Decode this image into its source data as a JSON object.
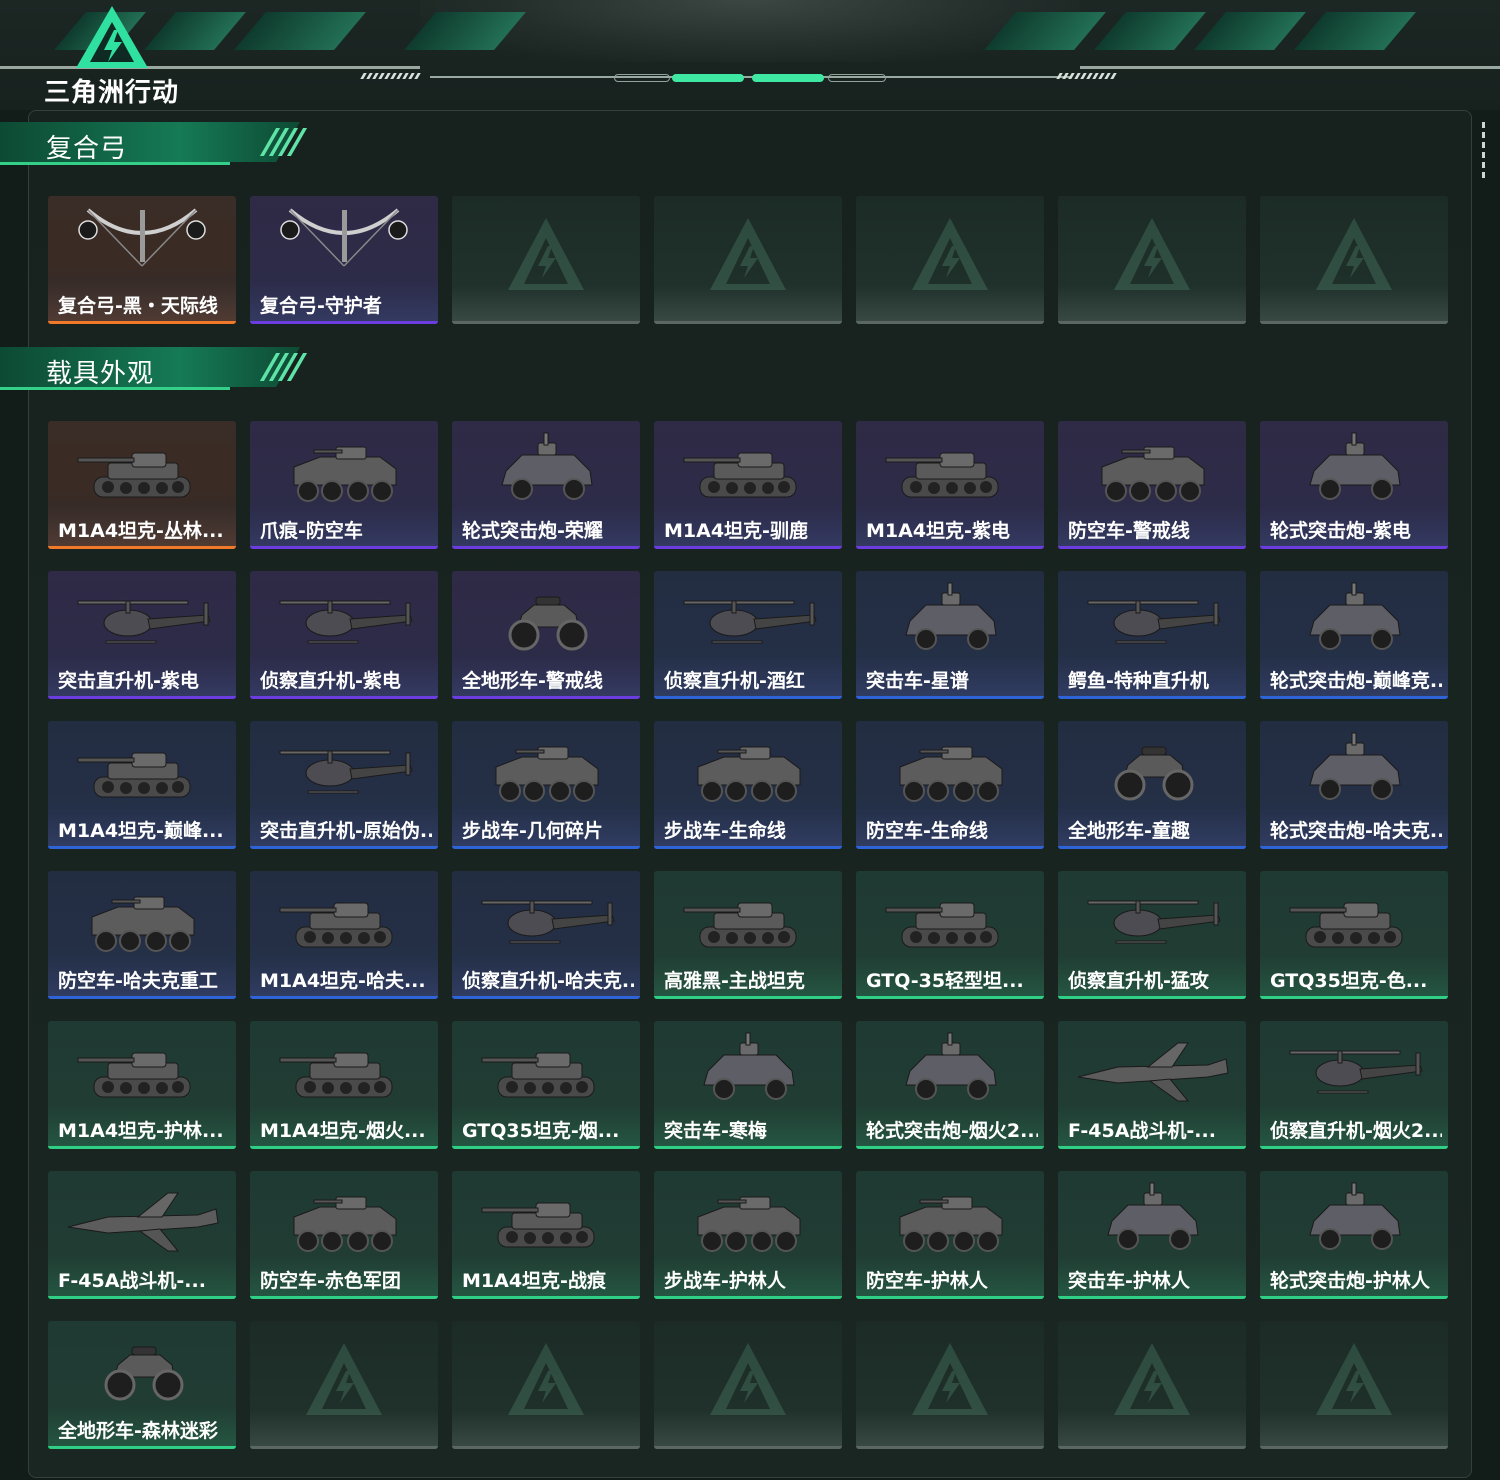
{
  "app": {
    "logo_text": "三角洲行动"
  },
  "colors": {
    "accent": "#34d08a",
    "orange": "#f07a2a",
    "purple": "#6b3de0",
    "blue": "#2f63d8",
    "green": "#2fcf85"
  },
  "sections": [
    {
      "title": "复合弓",
      "items": [
        {
          "label": "复合弓-黑・天际线",
          "rarity": "orange",
          "icon": "bow-icon"
        },
        {
          "label": "复合弓-守护者",
          "rarity": "purple",
          "icon": "bow-icon"
        },
        {
          "label": "",
          "rarity": "empty",
          "icon": ""
        },
        {
          "label": "",
          "rarity": "empty",
          "icon": ""
        },
        {
          "label": "",
          "rarity": "empty",
          "icon": ""
        },
        {
          "label": "",
          "rarity": "empty",
          "icon": ""
        },
        {
          "label": "",
          "rarity": "empty",
          "icon": ""
        }
      ]
    },
    {
      "title": "载具外观",
      "items": [
        {
          "label": "M1A4坦克-丛林...",
          "rarity": "orange",
          "icon": "tank-icon"
        },
        {
          "label": "爪痕-防空车",
          "rarity": "purple",
          "icon": "apc-icon"
        },
        {
          "label": "轮式突击炮-荣耀",
          "rarity": "purple",
          "icon": "armored-car-icon"
        },
        {
          "label": "M1A4坦克-驯鹿",
          "rarity": "purple",
          "icon": "tank-icon"
        },
        {
          "label": "M1A4坦克-紫电",
          "rarity": "purple",
          "icon": "tank-icon"
        },
        {
          "label": "防空车-警戒线",
          "rarity": "purple",
          "icon": "apc-icon"
        },
        {
          "label": "轮式突击炮-紫电",
          "rarity": "purple",
          "icon": "armored-car-icon"
        },
        {
          "label": "突击直升机-紫电",
          "rarity": "purple",
          "icon": "helicopter-icon"
        },
        {
          "label": "侦察直升机-紫电",
          "rarity": "purple",
          "icon": "helicopter-icon"
        },
        {
          "label": "全地形车-警戒线",
          "rarity": "purple",
          "icon": "atv-icon"
        },
        {
          "label": "侦察直升机-酒红",
          "rarity": "blue",
          "icon": "helicopter-icon"
        },
        {
          "label": "突击车-星谱",
          "rarity": "blue",
          "icon": "armored-car-icon"
        },
        {
          "label": "鳄鱼-特种直升机",
          "rarity": "blue",
          "icon": "helicopter-icon"
        },
        {
          "label": "轮式突击炮-巅峰竞...",
          "rarity": "blue",
          "icon": "armored-car-icon"
        },
        {
          "label": "M1A4坦克-巅峰...",
          "rarity": "blue",
          "icon": "tank-icon"
        },
        {
          "label": "突击直升机-原始伪...",
          "rarity": "blue",
          "icon": "helicopter-icon"
        },
        {
          "label": "步战车-几何碎片",
          "rarity": "blue",
          "icon": "apc-icon"
        },
        {
          "label": "步战车-生命线",
          "rarity": "blue",
          "icon": "apc-icon"
        },
        {
          "label": "防空车-生命线",
          "rarity": "blue",
          "icon": "apc-icon"
        },
        {
          "label": "全地形车-童趣",
          "rarity": "blue",
          "icon": "atv-icon"
        },
        {
          "label": "轮式突击炮-哈夫克...",
          "rarity": "blue",
          "icon": "armored-car-icon"
        },
        {
          "label": "防空车-哈夫克重工",
          "rarity": "blue",
          "icon": "apc-icon"
        },
        {
          "label": "M1A4坦克-哈夫...",
          "rarity": "blue",
          "icon": "tank-icon"
        },
        {
          "label": "侦察直升机-哈夫克...",
          "rarity": "blue",
          "icon": "helicopter-icon"
        },
        {
          "label": "高雅黑-主战坦克",
          "rarity": "green",
          "icon": "tank-icon"
        },
        {
          "label": "GTQ-35轻型坦...",
          "rarity": "green",
          "icon": "tank-icon"
        },
        {
          "label": "侦察直升机-猛攻",
          "rarity": "green",
          "icon": "helicopter-icon"
        },
        {
          "label": "GTQ35坦克-色...",
          "rarity": "green",
          "icon": "tank-icon"
        },
        {
          "label": "M1A4坦克-护林...",
          "rarity": "green",
          "icon": "tank-icon"
        },
        {
          "label": "M1A4坦克-烟火...",
          "rarity": "green",
          "icon": "tank-icon"
        },
        {
          "label": "GTQ35坦克-烟...",
          "rarity": "green",
          "icon": "tank-icon"
        },
        {
          "label": "突击车-寒梅",
          "rarity": "green",
          "icon": "armored-car-icon"
        },
        {
          "label": "轮式突击炮-烟火2...",
          "rarity": "green",
          "icon": "armored-car-icon"
        },
        {
          "label": "F-45A战斗机-...",
          "rarity": "green",
          "icon": "jet-icon"
        },
        {
          "label": "侦察直升机-烟火2...",
          "rarity": "green",
          "icon": "helicopter-icon"
        },
        {
          "label": "F-45A战斗机-...",
          "rarity": "green",
          "icon": "jet-icon"
        },
        {
          "label": "防空车-赤色军团",
          "rarity": "green",
          "icon": "apc-icon"
        },
        {
          "label": "M1A4坦克-战痕",
          "rarity": "green",
          "icon": "tank-icon"
        },
        {
          "label": "步战车-护林人",
          "rarity": "green",
          "icon": "apc-icon"
        },
        {
          "label": "防空车-护林人",
          "rarity": "green",
          "icon": "apc-icon"
        },
        {
          "label": "突击车-护林人",
          "rarity": "green",
          "icon": "armored-car-icon"
        },
        {
          "label": "轮式突击炮-护林人",
          "rarity": "green",
          "icon": "armored-car-icon"
        },
        {
          "label": "全地形车-森林迷彩",
          "rarity": "green",
          "icon": "atv-icon"
        },
        {
          "label": "",
          "rarity": "empty",
          "icon": ""
        },
        {
          "label": "",
          "rarity": "empty",
          "icon": ""
        },
        {
          "label": "",
          "rarity": "empty",
          "icon": ""
        },
        {
          "label": "",
          "rarity": "empty",
          "icon": ""
        },
        {
          "label": "",
          "rarity": "empty",
          "icon": ""
        },
        {
          "label": "",
          "rarity": "empty",
          "icon": ""
        }
      ]
    }
  ]
}
